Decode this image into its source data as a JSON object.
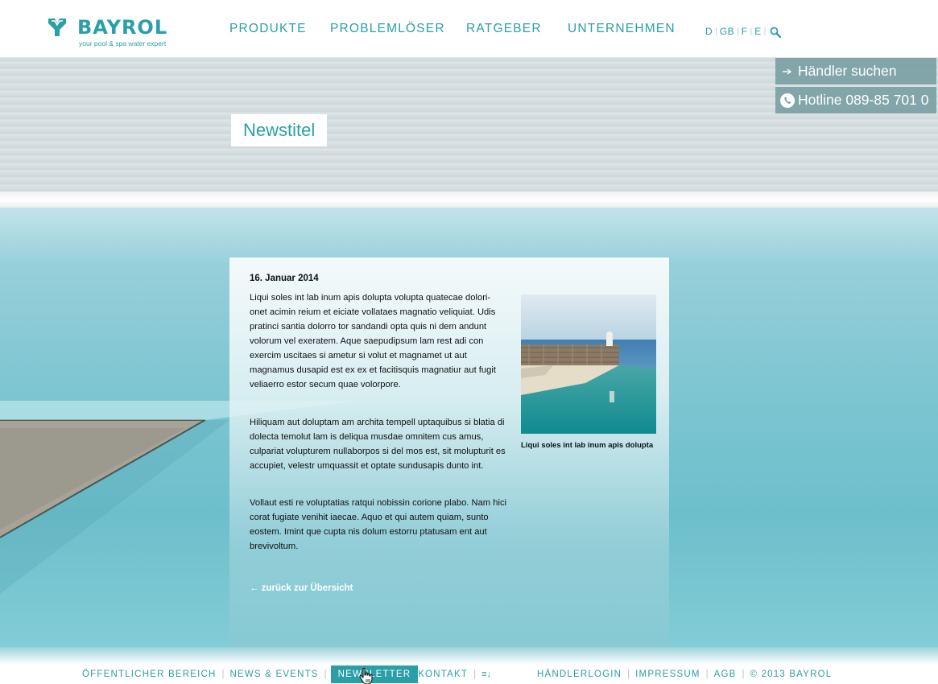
{
  "brand": {
    "name": "BAYROL",
    "tagline": "your pool & spa water expert",
    "color": "#2a9fa8"
  },
  "nav": {
    "items": [
      "PRODUKTE",
      "PROBLEMLÖSER",
      "RATGEBER",
      "UNTERNEHMEN"
    ]
  },
  "languages": [
    "D",
    "GB",
    "F",
    "E"
  ],
  "hero": {
    "title": "Newstitel"
  },
  "side_buttons": {
    "dealer": "Händler suchen",
    "hotline": "Hotline 089-85 701 0"
  },
  "article": {
    "date": "16. Januar 2014",
    "paragraphs": [
      "Liqui soles int lab inum apis dolupta volupta quatecae dolori-onet acimin reium et eiciate vollataes magnatio veliquiat. Udis pratinci santia dolorro tor sandandi opta quis ni dem andunt volorum vel exeratem. Aque saepudipsum lam rest adi con exercim uscitaes si ametur si volut et magnamet ut aut magnamus dusapid est ex ex et facitisquis magnatiur aut fugit veliaerro estor secum quae volorpore.",
      "Hiliquam aut doluptam am archita tempell uptaquibus si blatia di dolecta temolut lam is deliqua musdae omnitem cus amus, culpariat volupturem nullaborpos si del mos est, sit molupturit es accupiet, velestr umquassit et optate sundusapis dunto int.",
      "Vollaut esti re voluptatias ratqui nobissin corione plabo. Nam hici corat fugiate venihit iaecae. Aquo et qui autem quiam, sunto eostem. Imint que cupta nis dolum estorru ptatusam ent aut brevivoltum."
    ],
    "back_link": "← zurück zur Übersicht",
    "image_caption": "Liqui soles int lab inum apis dolupta"
  },
  "footer": {
    "left": [
      "ÖFFENTLICHER BEREICH",
      "NEWS & EVENTS",
      "NEWSLETTER",
      "KONTAKT"
    ],
    "active": "NEWSLETTER",
    "sitemap_icon": "≡↓",
    "right": [
      "HÄNDLERLOGIN",
      "IMPRESSUM",
      "AGB",
      "© 2013 BAYROL"
    ]
  },
  "icons": {
    "logo": "bayrol-logo-icon",
    "search": "search-icon",
    "arrow": "arrow-right-icon",
    "phone": "phone-icon",
    "sitemap": "sitemap-icon",
    "cursor": "hand-cursor-icon"
  }
}
